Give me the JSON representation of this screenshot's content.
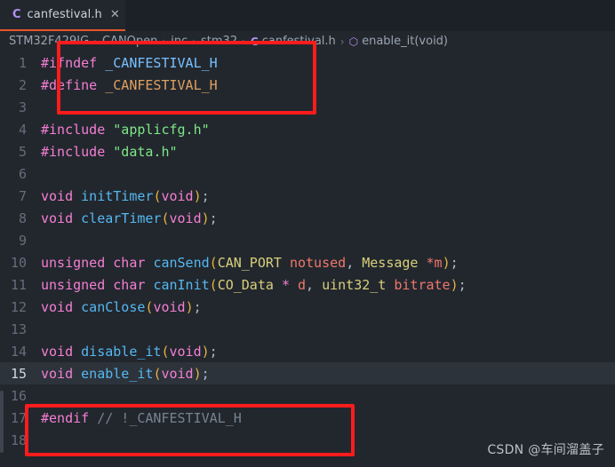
{
  "window": {
    "background_color": "#22272e"
  },
  "tabbar": {
    "background_color": "#1c2128",
    "active_tab_accent": "#e8562a",
    "tabs": [
      {
        "file_icon_label": "C",
        "title": "canfestival.h",
        "close_label": "✕",
        "active": true
      }
    ]
  },
  "breadcrumb": {
    "separator": "›",
    "items": [
      {
        "label": "STM32F429IG",
        "icon": null
      },
      {
        "label": "CANOpen",
        "icon": null
      },
      {
        "label": "inc",
        "icon": null
      },
      {
        "label": "stm32",
        "icon": null
      },
      {
        "label": "canfestival.h",
        "icon": "C"
      },
      {
        "label": "enable_it(void)",
        "icon": "⬡"
      }
    ]
  },
  "editor": {
    "active_line": 15,
    "active_line_bg": "#2d333b",
    "lines": [
      {
        "n": 1,
        "tokens": [
          {
            "t": "#ifndef",
            "c": "t-pp"
          },
          {
            "t": " ",
            "c": "t-punct"
          },
          {
            "t": "_CANFESTIVAL_H",
            "c": "t-macro"
          }
        ]
      },
      {
        "n": 2,
        "tokens": [
          {
            "t": "#define",
            "c": "t-pp"
          },
          {
            "t": " ",
            "c": "t-punct"
          },
          {
            "t": "_CANFESTIVAL_H",
            "c": "t-macro2"
          }
        ]
      },
      {
        "n": 3,
        "tokens": []
      },
      {
        "n": 4,
        "tokens": [
          {
            "t": "#include",
            "c": "t-pp"
          },
          {
            "t": " ",
            "c": "t-punct"
          },
          {
            "t": "\"applicfg.h\"",
            "c": "t-str"
          }
        ]
      },
      {
        "n": 5,
        "tokens": [
          {
            "t": "#include",
            "c": "t-pp"
          },
          {
            "t": " ",
            "c": "t-punct"
          },
          {
            "t": "\"data.h\"",
            "c": "t-str"
          }
        ]
      },
      {
        "n": 6,
        "tokens": []
      },
      {
        "n": 7,
        "tokens": [
          {
            "t": "void",
            "c": "t-kw"
          },
          {
            "t": " ",
            "c": "t-punct"
          },
          {
            "t": "initTimer",
            "c": "t-fn"
          },
          {
            "t": "(",
            "c": "t-paren"
          },
          {
            "t": "void",
            "c": "t-kw"
          },
          {
            "t": ")",
            "c": "t-paren"
          },
          {
            "t": ";",
            "c": "t-punct"
          }
        ]
      },
      {
        "n": 8,
        "tokens": [
          {
            "t": "void",
            "c": "t-kw"
          },
          {
            "t": " ",
            "c": "t-punct"
          },
          {
            "t": "clearTimer",
            "c": "t-fn"
          },
          {
            "t": "(",
            "c": "t-paren"
          },
          {
            "t": "void",
            "c": "t-kw"
          },
          {
            "t": ")",
            "c": "t-paren"
          },
          {
            "t": ";",
            "c": "t-punct"
          }
        ]
      },
      {
        "n": 9,
        "tokens": []
      },
      {
        "n": 10,
        "tokens": [
          {
            "t": "unsigned",
            "c": "t-kw"
          },
          {
            "t": " ",
            "c": "t-punct"
          },
          {
            "t": "char",
            "c": "t-kw"
          },
          {
            "t": " ",
            "c": "t-punct"
          },
          {
            "t": "canSend",
            "c": "t-fn"
          },
          {
            "t": "(",
            "c": "t-paren"
          },
          {
            "t": "CAN_PORT",
            "c": "t-type"
          },
          {
            "t": " ",
            "c": "t-punct"
          },
          {
            "t": "notused",
            "c": "t-param"
          },
          {
            "t": ", ",
            "c": "t-punct"
          },
          {
            "t": "Message",
            "c": "t-type"
          },
          {
            "t": " ",
            "c": "t-punct"
          },
          {
            "t": "*m",
            "c": "t-param"
          },
          {
            "t": ")",
            "c": "t-paren"
          },
          {
            "t": ";",
            "c": "t-punct"
          }
        ]
      },
      {
        "n": 11,
        "tokens": [
          {
            "t": "unsigned",
            "c": "t-kw"
          },
          {
            "t": " ",
            "c": "t-punct"
          },
          {
            "t": "char",
            "c": "t-kw"
          },
          {
            "t": " ",
            "c": "t-punct"
          },
          {
            "t": "canInit",
            "c": "t-fn"
          },
          {
            "t": "(",
            "c": "t-paren"
          },
          {
            "t": "CO_Data",
            "c": "t-type"
          },
          {
            "t": " ",
            "c": "t-punct"
          },
          {
            "t": "*",
            "c": "t-kw"
          },
          {
            "t": " ",
            "c": "t-punct"
          },
          {
            "t": "d",
            "c": "t-param"
          },
          {
            "t": ", ",
            "c": "t-punct"
          },
          {
            "t": "uint32_t",
            "c": "t-type"
          },
          {
            "t": " ",
            "c": "t-punct"
          },
          {
            "t": "bitrate",
            "c": "t-param"
          },
          {
            "t": ")",
            "c": "t-paren"
          },
          {
            "t": ";",
            "c": "t-punct"
          }
        ]
      },
      {
        "n": 12,
        "tokens": [
          {
            "t": "void",
            "c": "t-kw"
          },
          {
            "t": " ",
            "c": "t-punct"
          },
          {
            "t": "canClose",
            "c": "t-fn"
          },
          {
            "t": "(",
            "c": "t-paren"
          },
          {
            "t": "void",
            "c": "t-kw"
          },
          {
            "t": ")",
            "c": "t-paren"
          },
          {
            "t": ";",
            "c": "t-punct"
          }
        ]
      },
      {
        "n": 13,
        "tokens": []
      },
      {
        "n": 14,
        "tokens": [
          {
            "t": "void",
            "c": "t-kw"
          },
          {
            "t": " ",
            "c": "t-punct"
          },
          {
            "t": "disable_it",
            "c": "t-fn"
          },
          {
            "t": "(",
            "c": "t-paren"
          },
          {
            "t": "void",
            "c": "t-kw"
          },
          {
            "t": ")",
            "c": "t-paren"
          },
          {
            "t": ";",
            "c": "t-punct"
          }
        ]
      },
      {
        "n": 15,
        "tokens": [
          {
            "t": "void",
            "c": "t-kw"
          },
          {
            "t": " ",
            "c": "t-punct"
          },
          {
            "t": "enable_it",
            "c": "t-fn"
          },
          {
            "t": "(",
            "c": "t-paren"
          },
          {
            "t": "void",
            "c": "t-kw"
          },
          {
            "t": ")",
            "c": "t-paren"
          },
          {
            "t": ";",
            "c": "t-punct"
          }
        ]
      },
      {
        "n": 16,
        "tokens": []
      },
      {
        "n": 17,
        "tokens": [
          {
            "t": "#endif",
            "c": "t-pp"
          },
          {
            "t": " ",
            "c": "t-punct"
          },
          {
            "t": "// !_CANFESTIVAL_H",
            "c": "t-cmt"
          }
        ]
      },
      {
        "n": 18,
        "tokens": []
      }
    ]
  },
  "annotations": {
    "color": "#fc1c1c",
    "boxes": [
      {
        "name": "include-guard-open-highlight",
        "covers_lines": [
          1,
          2,
          3
        ]
      },
      {
        "name": "include-guard-close-highlight",
        "covers_lines": [
          16,
          17,
          18
        ]
      }
    ]
  },
  "watermark": {
    "text": "CSDN @车间溜盖子"
  }
}
